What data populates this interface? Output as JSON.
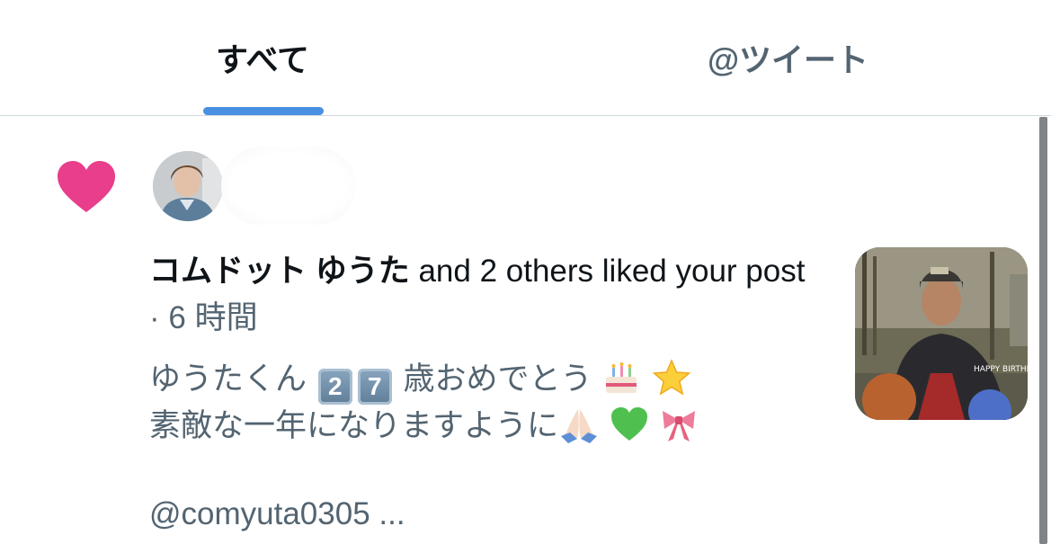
{
  "tabs": [
    {
      "label": "すべて",
      "active": true
    },
    {
      "label": "@ツイート",
      "active": false
    }
  ],
  "notification": {
    "actor": "コムドット ゆうた",
    "action": "and 2 others liked your post",
    "separator": "·",
    "time": "6 時間",
    "post_lines": [
      "ゆうたくん",
      "歳おめでとう",
      "素敵な一年になりますように"
    ],
    "keycaps": [
      "2",
      "7"
    ],
    "mention": "@comyuta0305 ...",
    "thumbnail_caption": "HAPPY BIRTHD"
  },
  "colors": {
    "heart": "#e83e8c",
    "tab_indicator": "#4a90e2",
    "secondary_text": "#536471",
    "primary_text": "#0f1419"
  },
  "icons": [
    "heart-icon",
    "birthday-cake-emoji",
    "star-emoji",
    "folded-hands-emoji",
    "green-heart-emoji",
    "ribbon-emoji"
  ]
}
